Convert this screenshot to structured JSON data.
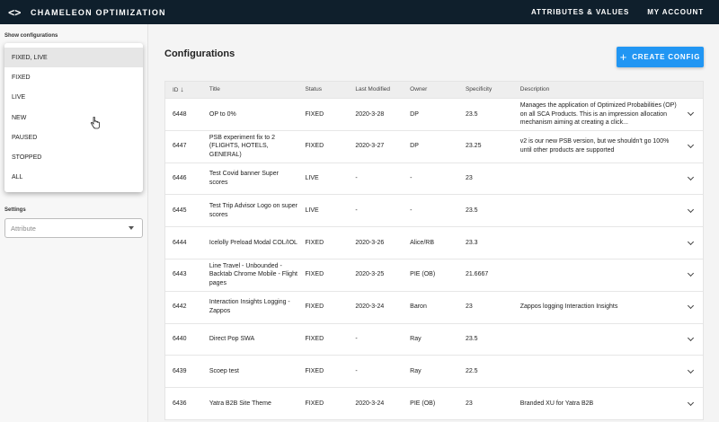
{
  "header": {
    "logo_mark": "<>",
    "app_title": "CHAMELEON OPTIMIZATION",
    "nav": [
      "ATTRIBUTES & VALUES",
      "MY ACCOUNT"
    ]
  },
  "sidebar": {
    "show_configurations_label": "Show configurations",
    "dropdown_options": [
      "FIXED, LIVE",
      "FIXED",
      "LIVE",
      "NEW",
      "PAUSED",
      "STOPPED",
      "ALL"
    ],
    "selected_option": "FIXED, LIVE",
    "settings_label": "Settings",
    "attribute_placeholder": "Attribute"
  },
  "main": {
    "title": "Configurations",
    "create_button": "CREATE CONFIG",
    "create_icon": "+",
    "sort_icon": "↓",
    "columns": [
      "ID",
      "Title",
      "Status",
      "Last Modified",
      "Owner",
      "Specificity",
      "Description"
    ],
    "rows": [
      {
        "id": "6448",
        "title": "OP to 0%",
        "status": "FIXED",
        "modified": "2020-3-28",
        "owner": "DP",
        "specificity": "23.5",
        "description": "Manages the application of Optimized Probabilities (OP) on all SCA Products. This is an impression allocation mechanism aiming at creating a click..."
      },
      {
        "id": "6447",
        "title": "PSB experiment fix to 2 (FLIGHTS, HOTELS, GENERAL)",
        "status": "FIXED",
        "modified": "2020-3-27",
        "owner": "DP",
        "specificity": "23.25",
        "description": "v2 is our new PSB version, but we shouldn't go 100% until other products are supported"
      },
      {
        "id": "6446",
        "title": "Test Covid banner Super scores",
        "status": "LIVE",
        "modified": "-",
        "owner": "-",
        "specificity": "23",
        "description": ""
      },
      {
        "id": "6445",
        "title": "Test Trip Advisor Logo on super scores",
        "status": "LIVE",
        "modified": "-",
        "owner": "-",
        "specificity": "23.5",
        "description": ""
      },
      {
        "id": "6444",
        "title": "Icelolly Preload Modal COL/IOL",
        "status": "FIXED",
        "modified": "2020-3-26",
        "owner": "Alice/RB",
        "specificity": "23.3",
        "description": ""
      },
      {
        "id": "6443",
        "title": "Line Travel - Unbounded - Backtab Chrome Mobile - Flight pages",
        "status": "FIXED",
        "modified": "2020-3-25",
        "owner": "PIE (OB)",
        "specificity": "21.6667",
        "description": ""
      },
      {
        "id": "6442",
        "title": "Interaction Insights Logging - Zappos",
        "status": "FIXED",
        "modified": "2020-3-24",
        "owner": "Baron",
        "specificity": "23",
        "description": "Zappos logging Interaction Insights"
      },
      {
        "id": "6440",
        "title": "Direct Pop SWA",
        "status": "FIXED",
        "modified": "-",
        "owner": "Ray",
        "specificity": "23.5",
        "description": ""
      },
      {
        "id": "6439",
        "title": "Scoep test",
        "status": "FIXED",
        "modified": "-",
        "owner": "Ray",
        "specificity": "22.5",
        "description": ""
      },
      {
        "id": "6436",
        "title": "Yatra B2B Site Theme",
        "status": "FIXED",
        "modified": "2020-3-24",
        "owner": "PIE (OB)",
        "specificity": "23",
        "description": "Branded XU for Yatra B2B"
      }
    ]
  },
  "colors": {
    "topbar": "#0f1f2c",
    "accent": "#2196f3"
  },
  "icons": {
    "logo": "logo-icon",
    "sort": "sort-down-icon",
    "expand": "chevron-down-icon",
    "add": "plus-icon",
    "cursor": "hand-cursor-icon",
    "caret": "caret-down-icon"
  }
}
